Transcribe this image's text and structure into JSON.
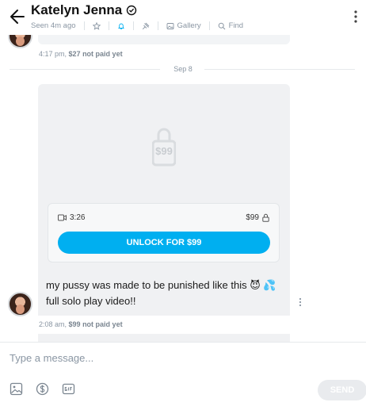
{
  "header": {
    "name": "Katelyn Jenna",
    "status": "Seen 4m ago",
    "gallery_label": "Gallery",
    "find_label": "Find"
  },
  "messages": [
    {
      "time": "4:17 pm,",
      "price_status": "$27 not paid yet"
    },
    {
      "date_divider": "Sep 8",
      "media": {
        "locked_price": "$99",
        "duration": "3:26",
        "price": "$99",
        "unlock_label": "UNLOCK FOR $99"
      },
      "text_line1": "my pussy was made to be punished like this 😈 💦",
      "text_line2": "full solo play video!!",
      "time": "2:08 am,",
      "price_status": "$99 not paid yet"
    }
  ],
  "composer": {
    "placeholder": "Type a message...",
    "send_label": "SEND"
  },
  "colors": {
    "accent": "#00aff0",
    "muted": "#8a96a3",
    "bubble": "#f0f1f3"
  },
  "icons": [
    "back-arrow-icon",
    "verified-icon",
    "star-icon",
    "bell-icon",
    "pin-icon",
    "gallery-icon",
    "search-icon",
    "more-icon",
    "lock-icon",
    "video-icon",
    "image-icon",
    "dollar-icon",
    "gif-icon"
  ]
}
